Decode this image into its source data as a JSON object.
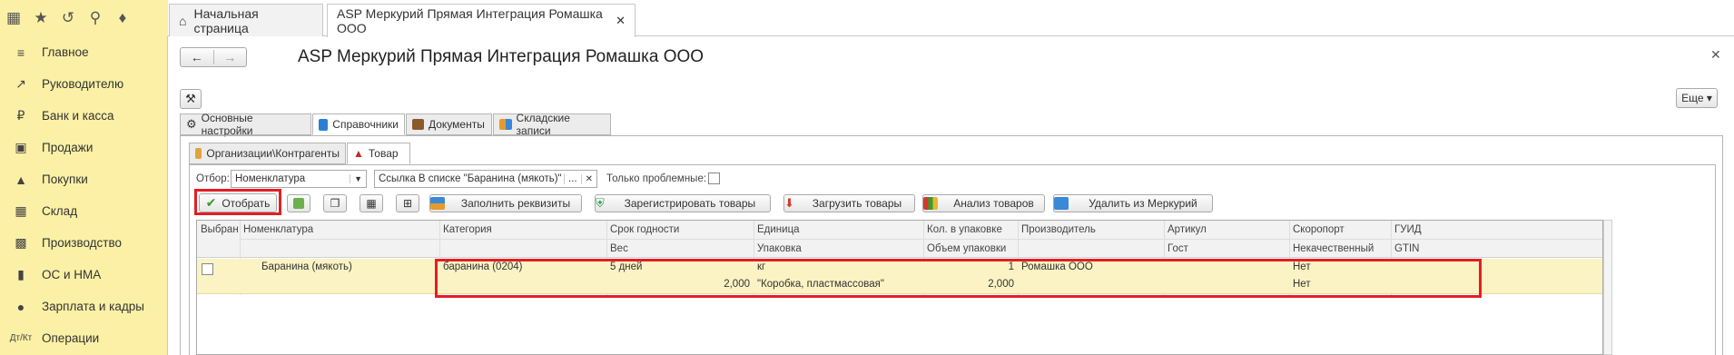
{
  "tabs": [
    {
      "label": "Начальная страница"
    },
    {
      "label": "ASP Меркурий Прямая Интеграция Ромашка ООО"
    }
  ],
  "sidebar": {
    "items": [
      {
        "label": "Главное",
        "icon": "menu-lines-icon"
      },
      {
        "label": "Руководителю",
        "icon": "chart-icon"
      },
      {
        "label": "Банк и касса",
        "icon": "ruble-coin-icon"
      },
      {
        "label": "Продажи",
        "icon": "bag-icon"
      },
      {
        "label": "Покупки",
        "icon": "cart-icon"
      },
      {
        "label": "Склад",
        "icon": "grid-icon"
      },
      {
        "label": "Производство",
        "icon": "factory-icon"
      },
      {
        "label": "ОС и НМА",
        "icon": "truck-icon"
      },
      {
        "label": "Зарплата и кадры",
        "icon": "person-icon"
      },
      {
        "label": "Операции",
        "icon": "debit-credit-icon"
      }
    ]
  },
  "form": {
    "title": "ASP Меркурий Прямая Интеграция Ромашка ООО",
    "more_label": "Еще ▾",
    "main_tabs": [
      "Основные настройки",
      "Справочники",
      "Документы",
      "Складские записи"
    ],
    "sub_tabs": [
      "Организации\\Контрагенты",
      "Товар"
    ],
    "filter": {
      "label": "Отбор:",
      "type_value": "Номенклатура",
      "ref_value": "Ссылка В списке \"Баранина (мякоть)\"",
      "only_problem_label": "Только проблемные:"
    },
    "toolbar": {
      "select_label": "Отобрать",
      "fill_label": "Заполнить реквизиты",
      "register_label": "Зарегистрировать товары",
      "load_label": "Загрузить товары",
      "analyze_label": "Анализ товаров",
      "delete_label": "Удалить из Меркурий"
    }
  },
  "grid": {
    "headers_top": [
      "Выбран",
      "Номенклатура",
      "Категория",
      "Срок годности",
      "Единица",
      "Кол. в упаковке",
      "Производитель",
      "Артикул",
      "Скоропорт",
      "ГУИД"
    ],
    "headers_bottom": [
      "Вес",
      "Упаковка",
      "Объем упаковки",
      "Гост",
      "Некачественный",
      "GTIN"
    ],
    "row": {
      "nomenclature": "Баранина (мякоть)",
      "category": "баранина (0204)",
      "shelf_life": "5 дней",
      "unit": "кг",
      "qty_in_pack": "1",
      "manufacturer": "Ромашка ООО",
      "perishable": "Нет",
      "weight": "2,000",
      "packaging": "\"Коробка, пластмассовая\"",
      "pack_volume": "2,000",
      "low_quality": "Нет"
    }
  },
  "colors": {
    "sidebar_bg": "#fbf0a5",
    "row_highlight": "#fbf3c4",
    "annotation_red": "#e31e24",
    "accent_green": "#4caf50"
  }
}
